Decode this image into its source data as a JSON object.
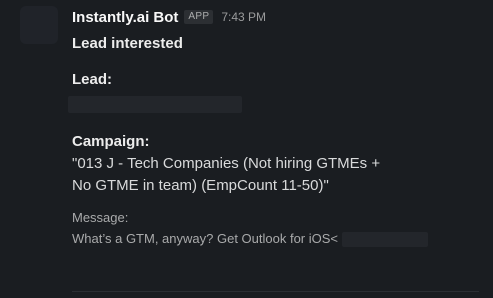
{
  "message": {
    "sender": "Instantly.ai Bot",
    "badge": "APP",
    "time": "7:43 PM",
    "title": "Lead interested",
    "lead_label": "Lead:",
    "campaign_label": "Campaign:",
    "campaign_value": "\"013 J - Tech Companies (Not hiring GTMEs + No GTME in team) (EmpCount 11-50)\"",
    "message_label": "Message:",
    "message_text": "What’s a GTM, anyway?  Get Outlook for iOS<"
  }
}
